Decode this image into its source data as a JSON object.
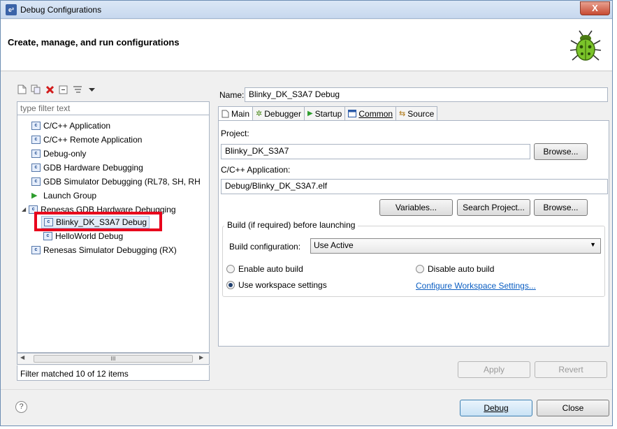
{
  "window": {
    "title": "Debug Configurations",
    "close_label": "X"
  },
  "header": {
    "title": "Create, manage, and run configurations"
  },
  "filter": {
    "placeholder": "type filter text"
  },
  "tree": [
    "C/C++ Application",
    "C/C++ Remote Application",
    "Debug-only",
    "GDB Hardware Debugging",
    "GDB Simulator Debugging (RL78, SH, RH",
    "Launch Group",
    "Renesas GDB Hardware Debugging",
    "Blinky_DK_S3A7 Debug",
    "HelloWorld Debug",
    "Renesas Simulator Debugging (RX)"
  ],
  "scroll_thumb": "III",
  "status": "Filter matched 10 of 12 items",
  "name": {
    "label": "Name:",
    "value": "Blinky_DK_S3A7 Debug"
  },
  "tabs": [
    "Main",
    "Debugger",
    "Startup",
    "Common",
    "Source"
  ],
  "main": {
    "project_label": "Project:",
    "project_value": "Blinky_DK_S3A7",
    "browse_label": "Browse...",
    "app_label": "C/C++ Application:",
    "app_value": "Debug/Blinky_DK_S3A7.elf",
    "variables_label": "Variables...",
    "search_project_label": "Search Project...",
    "browse2_label": "Browse...",
    "build_group": "Build (if required) before launching",
    "build_config_label": "Build configuration:",
    "build_config_value": "Use Active",
    "enable_auto_build": "Enable auto build",
    "disable_auto_build": "Disable auto build",
    "use_workspace": "Use workspace settings",
    "configure_link": "Configure Workspace Settings..."
  },
  "actions": {
    "apply": "Apply",
    "revert": "Revert",
    "debug": "Debug",
    "close": "Close",
    "help": "?"
  }
}
